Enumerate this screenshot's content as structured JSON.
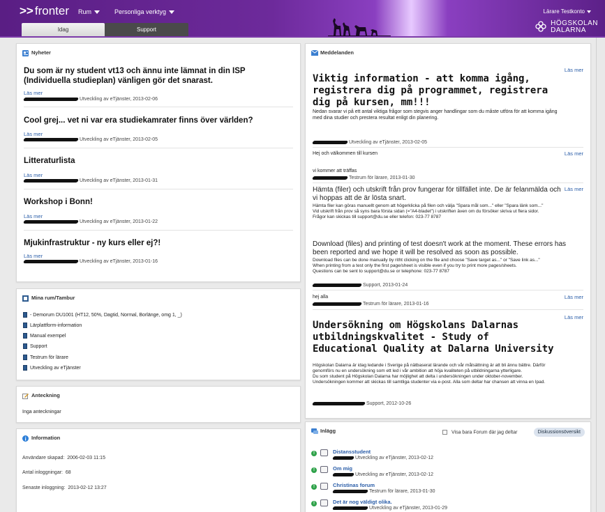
{
  "header": {
    "logo": "fronter",
    "menu_rum": "Rum",
    "menu_tools": "Personliga verktyg",
    "user": "Lärare Testkonto",
    "brand_line1": "HÖGSKOLAN",
    "brand_line2": "DALARNA",
    "tab_idag": "Idag",
    "tab_support": "Support"
  },
  "news": {
    "heading": "Nyheter",
    "items": [
      {
        "title": "Du som är ny student vt13 och ännu inte lämnat in din ISP (Individuella studieplan) vänligen gör det snarast.",
        "read_more": "Läs mer",
        "meta": "Utveckling av eTjänster, 2013-02-06"
      },
      {
        "title": "Cool grej... vet ni var era studiekamrater finns över världen?",
        "read_more": "Läs mer",
        "meta": "Utveckling av eTjänster, 2013-02-05"
      },
      {
        "title": "Litteraturlista",
        "read_more": "Läs mer",
        "meta": "Utveckling av eTjänster, 2013-01-31"
      },
      {
        "title": "Workshop i Bonn!",
        "read_more": "Läs mer",
        "meta": "Utveckling av eTjänster, 2013-01-22"
      },
      {
        "title": "Mjukinfrastruktur - ny kurs eller ej?!",
        "read_more": "Läs mer",
        "meta": "Utveckling av eTjänster, 2013-01-16"
      }
    ]
  },
  "rooms": {
    "heading": "Mina rum/Tambur",
    "items": [
      "- Demorum DU1001 (HT12, 50%, Dagtid, Normal, Borlänge, omg 1, _)",
      "Lärplattform-information",
      "Manual exempel",
      "Support",
      "Testrum för lärare",
      "Utveckling av eTjänster"
    ]
  },
  "notes": {
    "heading": "Anteckning",
    "empty": "Inga anteckningar"
  },
  "info": {
    "heading": "Information",
    "created_label": "Användare skapad:",
    "created_value": "2006-02-03 11:15",
    "logins_label": "Antal inloggningar:",
    "logins_value": "68",
    "last_label": "Senaste inloggning:",
    "last_value": "2013-02-12 13:27"
  },
  "messages": {
    "heading": "Meddelanden",
    "read_more": "Läs mer",
    "m1_title": "Viktig information - att komma igång, registrera dig på programmet, registrera dig på kursen, mm!!!",
    "m1_body": "Nedan svarar vi på ett antal viktiga frågor som stegvis anger handlingar som du måste utföra för att komma igång med dina studier och prestera resultat enligt din planering.",
    "m1_meta": "Utveckling av eTjänster, 2013-02-05",
    "m2_body": "Hej och välkommen till  kursen",
    "m2_line": "vi kommer att träffas",
    "m2_meta": "Testrum för lärare, 2013-01-30",
    "m3_title": "Hämta (filer) och utskrift från prov fungerar för tillfället inte. De är felanmälda och vi hoppas att de är lösta snart.",
    "m3_body": "Hämta filer kan göras manuellt genom att högerklicka på filen och välja \"Spara mål som...\" eller \"Spara länk som...\"\nVid utskrift från prov så syns bara första sidan (=\"A4-bladet\") i utskriften även om du försöker skriva ut flera sidor.\nFrågor kan skickas till support@du.se eller telefon: 023-77 8787",
    "m3_title_en": "Download (files) and printing of test doesn't work at the moment. These errors has been reported and we hope it will be resolved as soon as possible.",
    "m3_body_en": "Download files can be done manually by ritht clicking on the file and choose \"Save target as...\" or \"Save link as...\"\nWhen printing from a test only the first page/sheet is visible even if you try to print more pages/sheets.\nQuestions can be sent to support@du.se or telephone: 023-77 8787",
    "m3_meta": "Support, 2013-01-24",
    "m4_body": "hej alla",
    "m4_meta": "Testrum för lärare, 2013-01-16",
    "m5_title": "Undersökning om Högskolans Dalarnas utbildningskvalitet - Study of Educational Quality at Dalarna University",
    "m5_body": "Högskolan Dalarna är idag ledande i Sverige på nätbaserat lärande och vår målsättning är att bli ännu bättre. Därför genomförs nu en undersökning som ett led i vår ambition att höja kvaliteten på utbildningarna ytterligare.\nDu som student på Högskolan Dalarna har möjlighet att delta i undersökningen under oktober-november. Undersökningen kommer att skickas till samtliga studenter via e-post. Alla som deltar har chansen att vinna en Ipad.",
    "m5_meta": "Support, 2012-10-26"
  },
  "posts": {
    "heading": "Inlägg",
    "only_forum": "Visa bara Forum där jag deltar",
    "overview": "Diskussionsöversikt",
    "items": [
      {
        "title": "Distansstudent",
        "meta": "Utveckling av eTjänster, 2013-02-12"
      },
      {
        "title": "Om mig",
        "meta": "Utveckling av eTjänster, 2013-02-12"
      },
      {
        "title": "Christinas forum",
        "meta": "Testrum för lärare, 2013-01-30"
      },
      {
        "title": "Det är nog väldigt olika.",
        "meta": "Utveckling av eTjänster, 2013-01-29"
      }
    ]
  },
  "colors": {
    "brand_purple": "#6d2a9b",
    "link": "#2a5da8",
    "new_dot": "#2fa24a"
  }
}
